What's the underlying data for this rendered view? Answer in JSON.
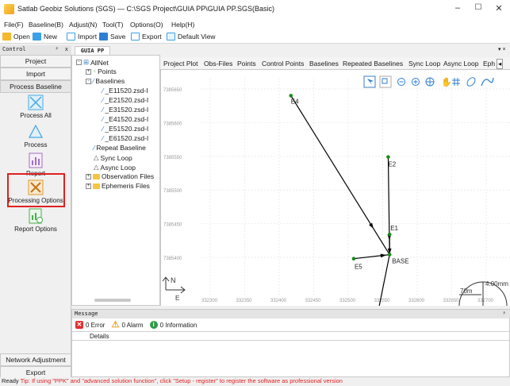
{
  "window": {
    "title": "Satlab Geobiz Solutions (SGS) — C:\\SGS Project\\GUIA PP\\GUIA PP.SGS(Basic)",
    "minimize": "–",
    "maximize": "☐",
    "close": "✕"
  },
  "menu": [
    "File(F)",
    "Baseline(B)",
    "Adjust(N)",
    "Tool(T)",
    "Options(O)",
    "Help(H)"
  ],
  "toolbar": {
    "open": "Open",
    "new": "New",
    "import": "Import",
    "save": "Save",
    "export": "Export",
    "default_view": "Default View"
  },
  "control_panel": {
    "title": "Control",
    "pin": "ᵖ",
    "close": "x",
    "tabs_top": [
      "Project",
      "Import",
      "Process Baseline"
    ],
    "items": [
      "Process All",
      "Process",
      "Report",
      "Processing Options",
      "Report Options"
    ],
    "tabs_bottom": [
      "Network Adjustment",
      "Export"
    ]
  },
  "document_tab": "GUIA PP",
  "tree": {
    "root": "AllNet",
    "points": "Points",
    "baselines": "Baselines",
    "baseline_items": [
      "_E11520.zsd-I",
      "_E21520.zsd-I",
      "_E31520.zsd-I",
      "_E41520.zsd-I",
      "_E51520.zsd-I",
      "_E61520.zsd-I"
    ],
    "repeat_baseline": "Repeat Baseline",
    "sync_loop": "Sync Loop",
    "async_loop": "Async Loop",
    "observation_files": "Observation Files",
    "ephemeris_files": "Ephemeris Files"
  },
  "view_tabs": [
    "Project Plot",
    "Obs-Files",
    "Points",
    "Control Points",
    "Baselines",
    "Repeated Baselines",
    "Sync Loop",
    "Async Loop",
    "Eph"
  ],
  "plot": {
    "y_ticks": [
      "7385650",
      "7385600",
      "7385550",
      "7385500",
      "7385450",
      "7385400"
    ],
    "x_ticks": [
      "332300",
      "332350",
      "332400",
      "332450",
      "332500",
      "332550",
      "332600",
      "332650",
      "332700"
    ],
    "axis_x_letter": "E",
    "north_letter": "N",
    "points": [
      {
        "name": "E4",
        "x": 332417,
        "y": 7385640
      },
      {
        "name": "E2",
        "x": 332558,
        "y": 7385549
      },
      {
        "name": "E1",
        "x": 332560,
        "y": 7385434
      },
      {
        "name": "BASE",
        "x": 332560,
        "y": 7385404
      },
      {
        "name": "E5",
        "x": 332508,
        "y": 7385398
      }
    ],
    "scale_label": "70m",
    "scale_value": "4.00mm",
    "colors": {
      "point": "#1a8a1a",
      "baseline": "#000000",
      "background": "#ffffff"
    }
  },
  "message_panel": {
    "title": "Message",
    "pin": "ᵖ",
    "error": "0 Error",
    "alarm": "0 Alarm",
    "information": "0 Information",
    "details_header": "Details"
  },
  "status": {
    "ready": "Ready",
    "tip": "Tip: If using \"PPK\" and \"advanced solution function\", click \"Setup - register\" to register the software as professional version"
  }
}
